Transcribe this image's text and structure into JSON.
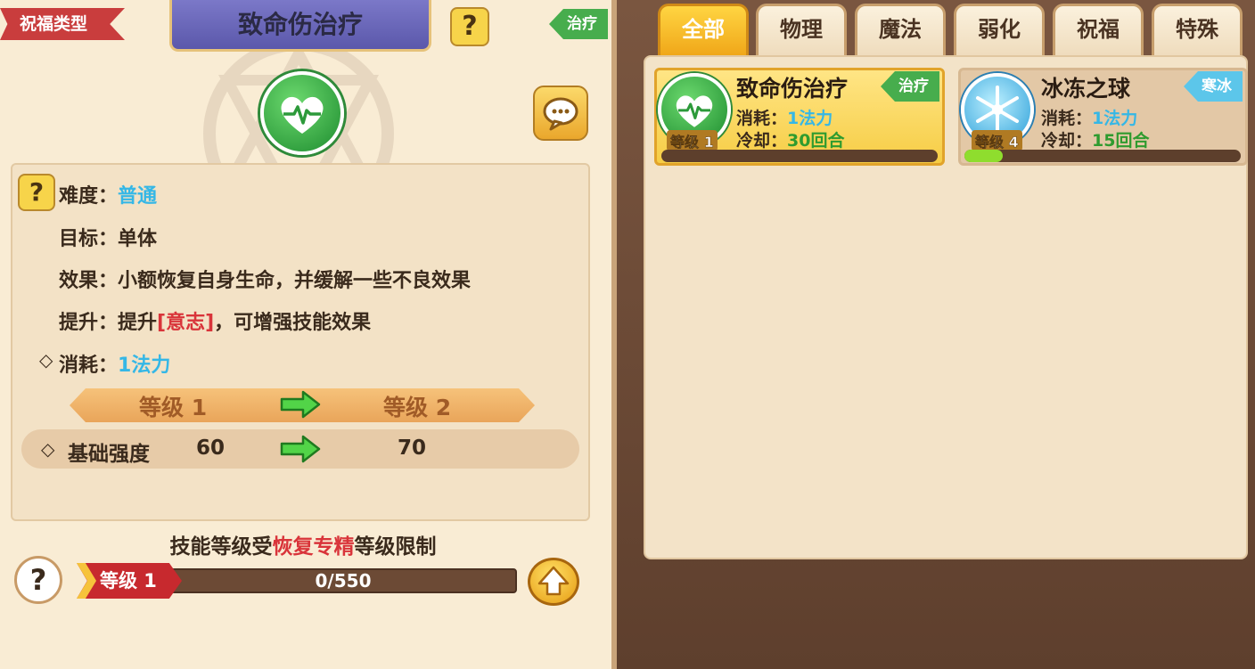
{
  "detail": {
    "type_ribbon": "祝福类型",
    "title": "致命伤治疗",
    "help": "?",
    "category_tag": "治疗",
    "difficulty_label": "难度：",
    "difficulty_value": "普通",
    "target_label": "目标：",
    "target_value": "单体",
    "effect_label": "效果：",
    "effect_value": "小额恢复自身生命，并缓解一些不良效果",
    "upgrade_label": "提升：",
    "upgrade_prefix": "提升",
    "upgrade_attr": "[意志]",
    "upgrade_suffix": "，可增强技能效果",
    "diamond": "◇",
    "cost_label": "消耗：",
    "cost_value": "1法力",
    "level_from": "等级 1",
    "level_to": "等级 2",
    "stat_name": "基础强度",
    "stat_from": "60",
    "stat_to": "70",
    "limit_prefix": "技能等级受",
    "limit_highlight": "恢复专精",
    "limit_suffix": "等级限制",
    "current_level": "等级 1",
    "exp_text": "0/550",
    "exp_fraction": 0,
    "help_bottom": "?"
  },
  "tabs": [
    {
      "label": "全部",
      "active": true
    },
    {
      "label": "物理",
      "active": false
    },
    {
      "label": "魔法",
      "active": false
    },
    {
      "label": "弱化",
      "active": false
    },
    {
      "label": "祝福",
      "active": false
    },
    {
      "label": "特殊",
      "active": false
    }
  ],
  "skills": [
    {
      "name": "致命伤治疗",
      "tag": "治疗",
      "cost_label": "消耗：",
      "cost_value": "1法力",
      "cd_label": "冷却：",
      "cd_value": "30回合",
      "level": "等级 1",
      "progress": 0,
      "selected": true
    },
    {
      "name": "冰冻之球",
      "tag": "寒冰",
      "cost_label": "消耗：",
      "cost_value": "1法力",
      "cd_label": "冷却：",
      "cd_value": "15回合",
      "level": "等级 4",
      "progress": 0.14,
      "selected": false
    }
  ],
  "colors": {
    "heal_green": "#47ad4d",
    "ice_blue": "#5cc6ea",
    "tab_active": "#f0a719",
    "highlight_red": "#d9343a",
    "value_blue": "#35b7e6"
  }
}
